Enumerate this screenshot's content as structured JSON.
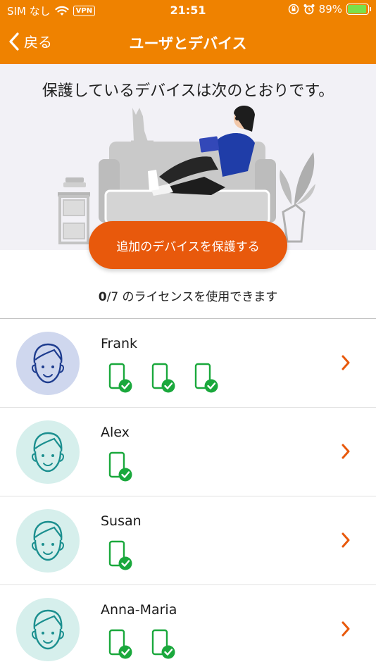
{
  "status": {
    "carrier": "SIM なし",
    "vpn": "VPN",
    "time": "21:51",
    "battery": "89%"
  },
  "nav": {
    "back_label": "戻る",
    "title": "ユーザとデバイス"
  },
  "hero": {
    "title": "保護しているデバイスは次のとおりです。"
  },
  "cta": {
    "label": "追加のデバイスを保護する"
  },
  "license": {
    "used": "0",
    "total": "/7",
    "text": " のライセンスを使用できます"
  },
  "users": [
    {
      "name": "Frank",
      "devices": 3,
      "avatar_bg": "#cfd7ee",
      "avatar_stroke": "#1f3d8f"
    },
    {
      "name": "Alex",
      "devices": 1,
      "avatar_bg": "#d6efec",
      "avatar_stroke": "#1b8f8f"
    },
    {
      "name": "Susan",
      "devices": 1,
      "avatar_bg": "#d6efec",
      "avatar_stroke": "#1b8f8f"
    },
    {
      "name": "Anna-Maria",
      "devices": 2,
      "avatar_bg": "#d6efec",
      "avatar_stroke": "#1b8f8f"
    }
  ],
  "colors": {
    "header": "#ef8200",
    "accent": "#e8590c",
    "device_green": "#1aa83c"
  }
}
